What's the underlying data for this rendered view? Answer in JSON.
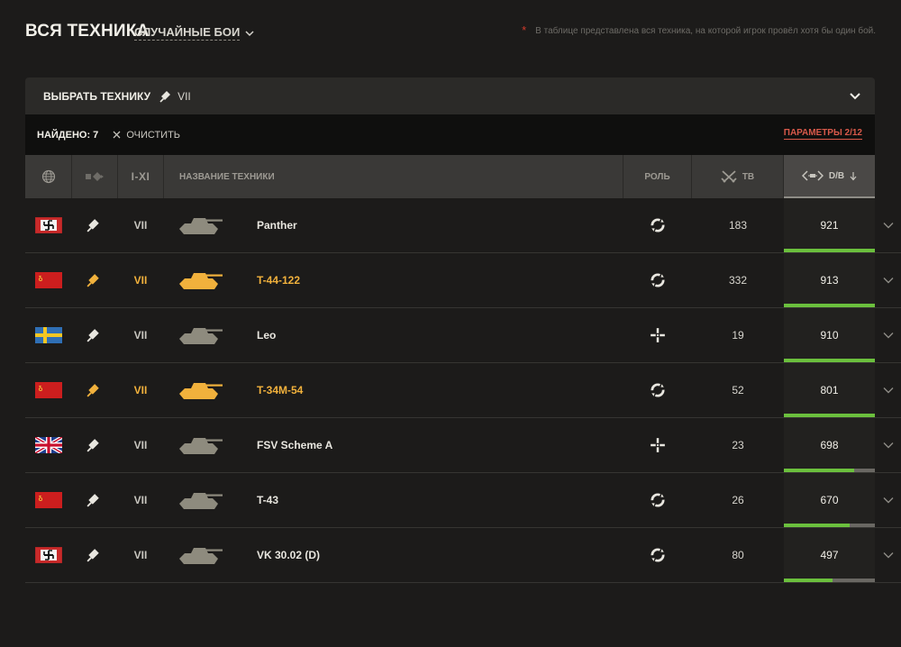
{
  "header": {
    "title": "ВСЯ ТЕХНИКА",
    "mode": "СЛУЧАЙНЫЕ БОИ",
    "note_star": "*",
    "note": "В таблице представлена вся техника, на которой игрок провёл хотя бы один бой."
  },
  "filter": {
    "title": "ВЫБРАТЬ ТЕХНИКУ",
    "chip": "VII"
  },
  "found_bar": {
    "found": "НАЙДЕНО: 7",
    "clear": "ОЧИСТИТЬ",
    "params": "ПАРАМЕТРЫ 2/12"
  },
  "columns": {
    "tier": "I-XI",
    "name": "НАЗВАНИЕ ТЕХНИКИ",
    "role": "РОЛЬ",
    "battles": "ТВ",
    "damage": "D/B"
  },
  "colors": {
    "accent_red": "#d8594a",
    "premium": "#f1b13c",
    "bar_green": "#6bc03d",
    "regular_tank": "#8e8b7e"
  },
  "rows": [
    {
      "nation": "germany",
      "tier": "VII",
      "name": "Panther",
      "premium": false,
      "role": "assault-role-icon",
      "battles": "183",
      "damage": "921",
      "bar": 1.0
    },
    {
      "nation": "ussr",
      "tier": "VII",
      "name": "T-44-122",
      "premium": true,
      "role": "assault-role-icon",
      "battles": "332",
      "damage": "913",
      "bar": 1.0
    },
    {
      "nation": "sweden",
      "tier": "VII",
      "name": "Leo",
      "premium": false,
      "role": "support-role-icon",
      "battles": "19",
      "damage": "910",
      "bar": 1.0
    },
    {
      "nation": "ussr",
      "tier": "VII",
      "name": "T-34M-54",
      "premium": true,
      "role": "assault-role-icon",
      "battles": "52",
      "damage": "801",
      "bar": 1.0
    },
    {
      "nation": "uk",
      "tier": "VII",
      "name": "FSV Scheme A",
      "premium": false,
      "role": "support-role-icon",
      "battles": "23",
      "damage": "698",
      "bar": 0.77
    },
    {
      "nation": "ussr",
      "tier": "VII",
      "name": "T-43",
      "premium": false,
      "role": "assault-role-icon",
      "battles": "26",
      "damage": "670",
      "bar": 0.72
    },
    {
      "nation": "germany",
      "tier": "VII",
      "name": "VK 30.02 (D)",
      "premium": false,
      "role": "assault-role-icon",
      "battles": "80",
      "damage": "497",
      "bar": 0.53
    }
  ]
}
